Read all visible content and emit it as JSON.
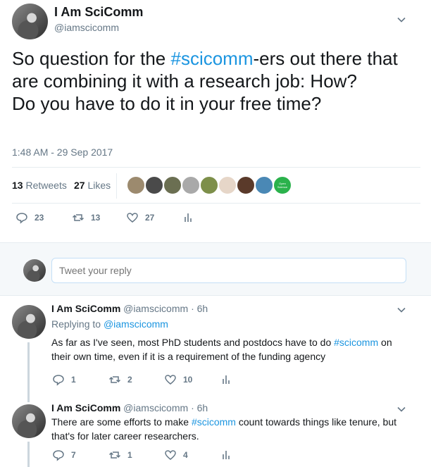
{
  "main_tweet": {
    "author_name": "I Am SciComm",
    "author_handle": "@iamscicomm",
    "text_parts": [
      "So question for the ",
      "#scicomm",
      "-ers out there that are combining it with a research job: How?",
      "Do you have to do it in your free time?"
    ],
    "timestamp": "1:48 AM - 29 Sep 2017",
    "retweet_count": "13",
    "retweet_label": "Retweets",
    "like_count": "27",
    "like_label": "Likes",
    "likers": [
      {
        "color": "#9c8a6e"
      },
      {
        "color": "#4a4a4a"
      },
      {
        "color": "#6b6f52"
      },
      {
        "color": "#a9a9a9"
      },
      {
        "color": "#7d8f4a"
      },
      {
        "color": "#e6d6c8"
      },
      {
        "color": "#5a3a2a"
      },
      {
        "color": "#4a88b5"
      },
      {
        "color": "#2bb24c",
        "text": "Open Science"
      }
    ],
    "actions": {
      "reply_count": "23",
      "retweet_count": "13",
      "like_count": "27"
    }
  },
  "reply_box": {
    "placeholder": "Tweet your reply"
  },
  "replies": [
    {
      "author_name": "I Am SciComm",
      "author_handle": "@iamscicomm",
      "time": "6h",
      "replying_to_label": "Replying to",
      "replying_to_handle": "@iamscicomm",
      "text_parts": [
        "As far as I've seen, most PhD students and postdocs have to do ",
        "#scicomm",
        " on their own time, even if it is a requirement of the funding agency"
      ],
      "reply_count": "1",
      "retweet_count": "2",
      "like_count": "10"
    },
    {
      "author_name": "I Am SciComm",
      "author_handle": "@iamscicomm",
      "time": "6h",
      "text_parts": [
        "There are some efforts to make ",
        "#scicomm",
        " count towards things like tenure, but that's for later career researchers."
      ],
      "reply_count": "7",
      "retweet_count": "1",
      "like_count": "4"
    }
  ],
  "colors": {
    "link": "#1b95e0",
    "secondary": "#657786",
    "primary": "#14171a"
  }
}
